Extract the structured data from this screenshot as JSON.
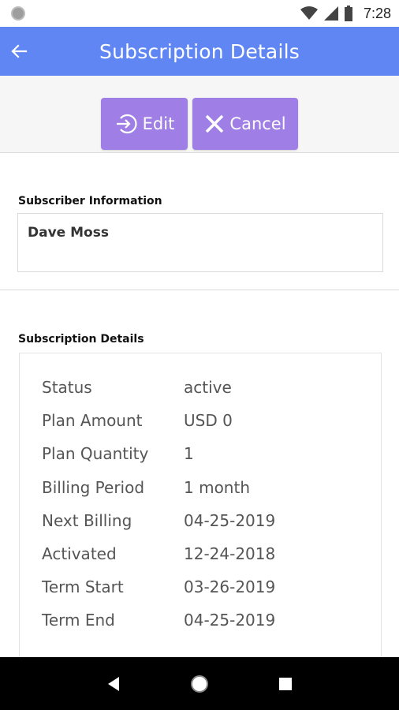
{
  "status_bar": {
    "time": "7:28"
  },
  "app_bar": {
    "title": "Subscription Details"
  },
  "actions": {
    "edit_label": "Edit",
    "cancel_label": "Cancel"
  },
  "subscriber": {
    "section_label": "Subscriber Information",
    "name": "Dave Moss"
  },
  "subscription": {
    "section_label": "Subscription Details",
    "rows": [
      {
        "label": "Status",
        "value": "active"
      },
      {
        "label": "Plan Amount",
        "value": "USD 0"
      },
      {
        "label": "Plan Quantity",
        "value": "1"
      },
      {
        "label": "Billing Period",
        "value": "1 month"
      },
      {
        "label": "Next Billing",
        "value": "04-25-2019"
      },
      {
        "label": "Activated",
        "value": "12-24-2018"
      },
      {
        "label": "Term Start",
        "value": "03-26-2019"
      },
      {
        "label": "Term End",
        "value": "04-25-2019"
      }
    ]
  },
  "colors": {
    "app_bar": "#5f86f2",
    "button": "#9f7fe6"
  },
  "icons": {
    "back": "arrow-left-icon",
    "edit": "sign-in-icon",
    "cancel": "close-icon",
    "nav_back": "triangle-back-icon",
    "nav_home": "circle-home-icon",
    "nav_recents": "square-recents-icon"
  }
}
